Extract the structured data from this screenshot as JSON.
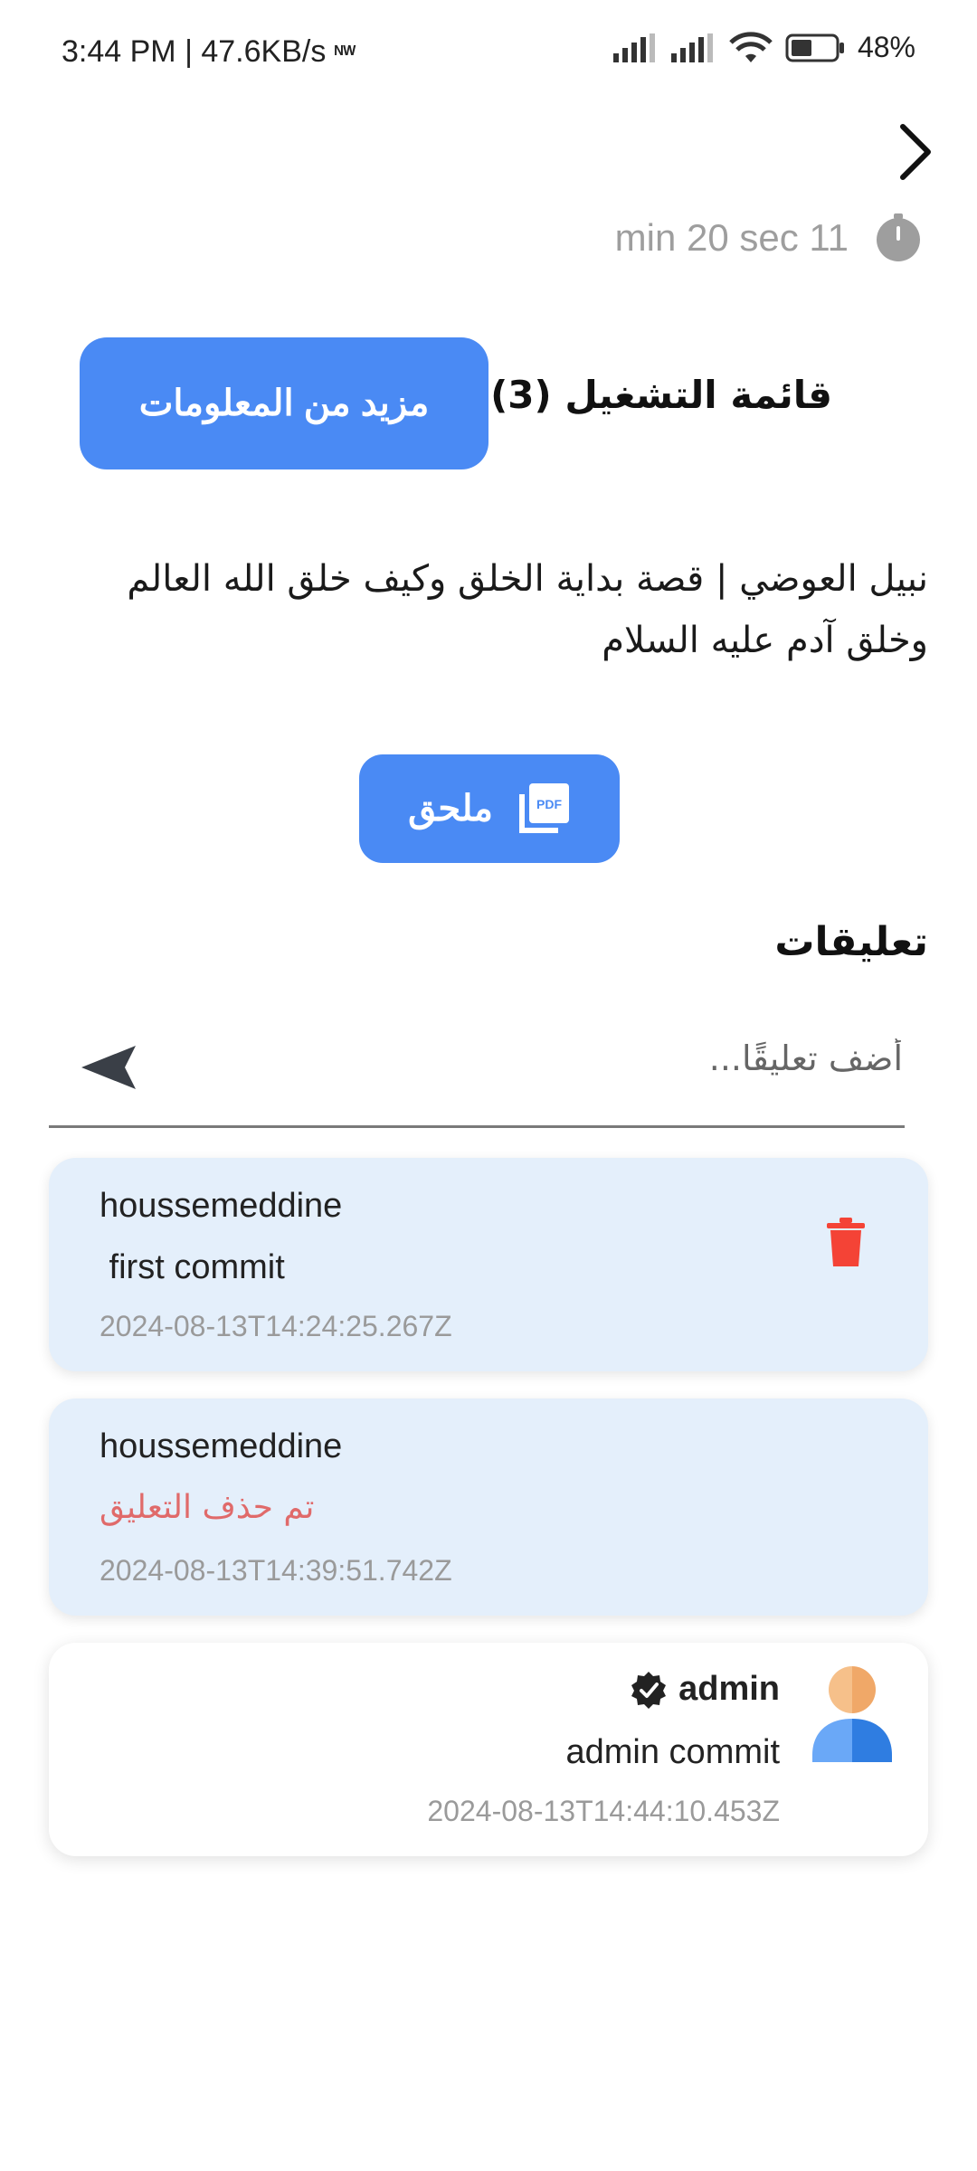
{
  "status_bar": {
    "time": "3:44 PM | 47.6KB/s",
    "battery": "48%"
  },
  "timer": {
    "text": "min 20 sec 11"
  },
  "playlist": {
    "label": "قائمة التشغيل (3)"
  },
  "more_info_button": {
    "label": "مزيد من المعلومات"
  },
  "video": {
    "title": "نبيل العوضي | قصة بداية الخلق وكيف خلق الله العالم وخلق آدم عليه السلام"
  },
  "attachment_button": {
    "label": "ملحق"
  },
  "comments": {
    "heading": "تعليقات",
    "input_placeholder": "أضف تعليقًا...",
    "items": [
      {
        "user": "houssemeddine",
        "message": " first commit",
        "time": "2024-08-13T14:24:25.267Z"
      },
      {
        "user": "houssemeddine",
        "message": "تم حذف التعليق",
        "time": "2024-08-13T14:39:51.742Z"
      },
      {
        "user": "admin",
        "message": "admin commit",
        "time": "2024-08-13T14:44:10.453Z"
      }
    ]
  },
  "colors": {
    "accent": "#4a8af4",
    "card_bg": "#e4effb",
    "danger": "#f44336",
    "deleted_text": "#e06a6a"
  }
}
